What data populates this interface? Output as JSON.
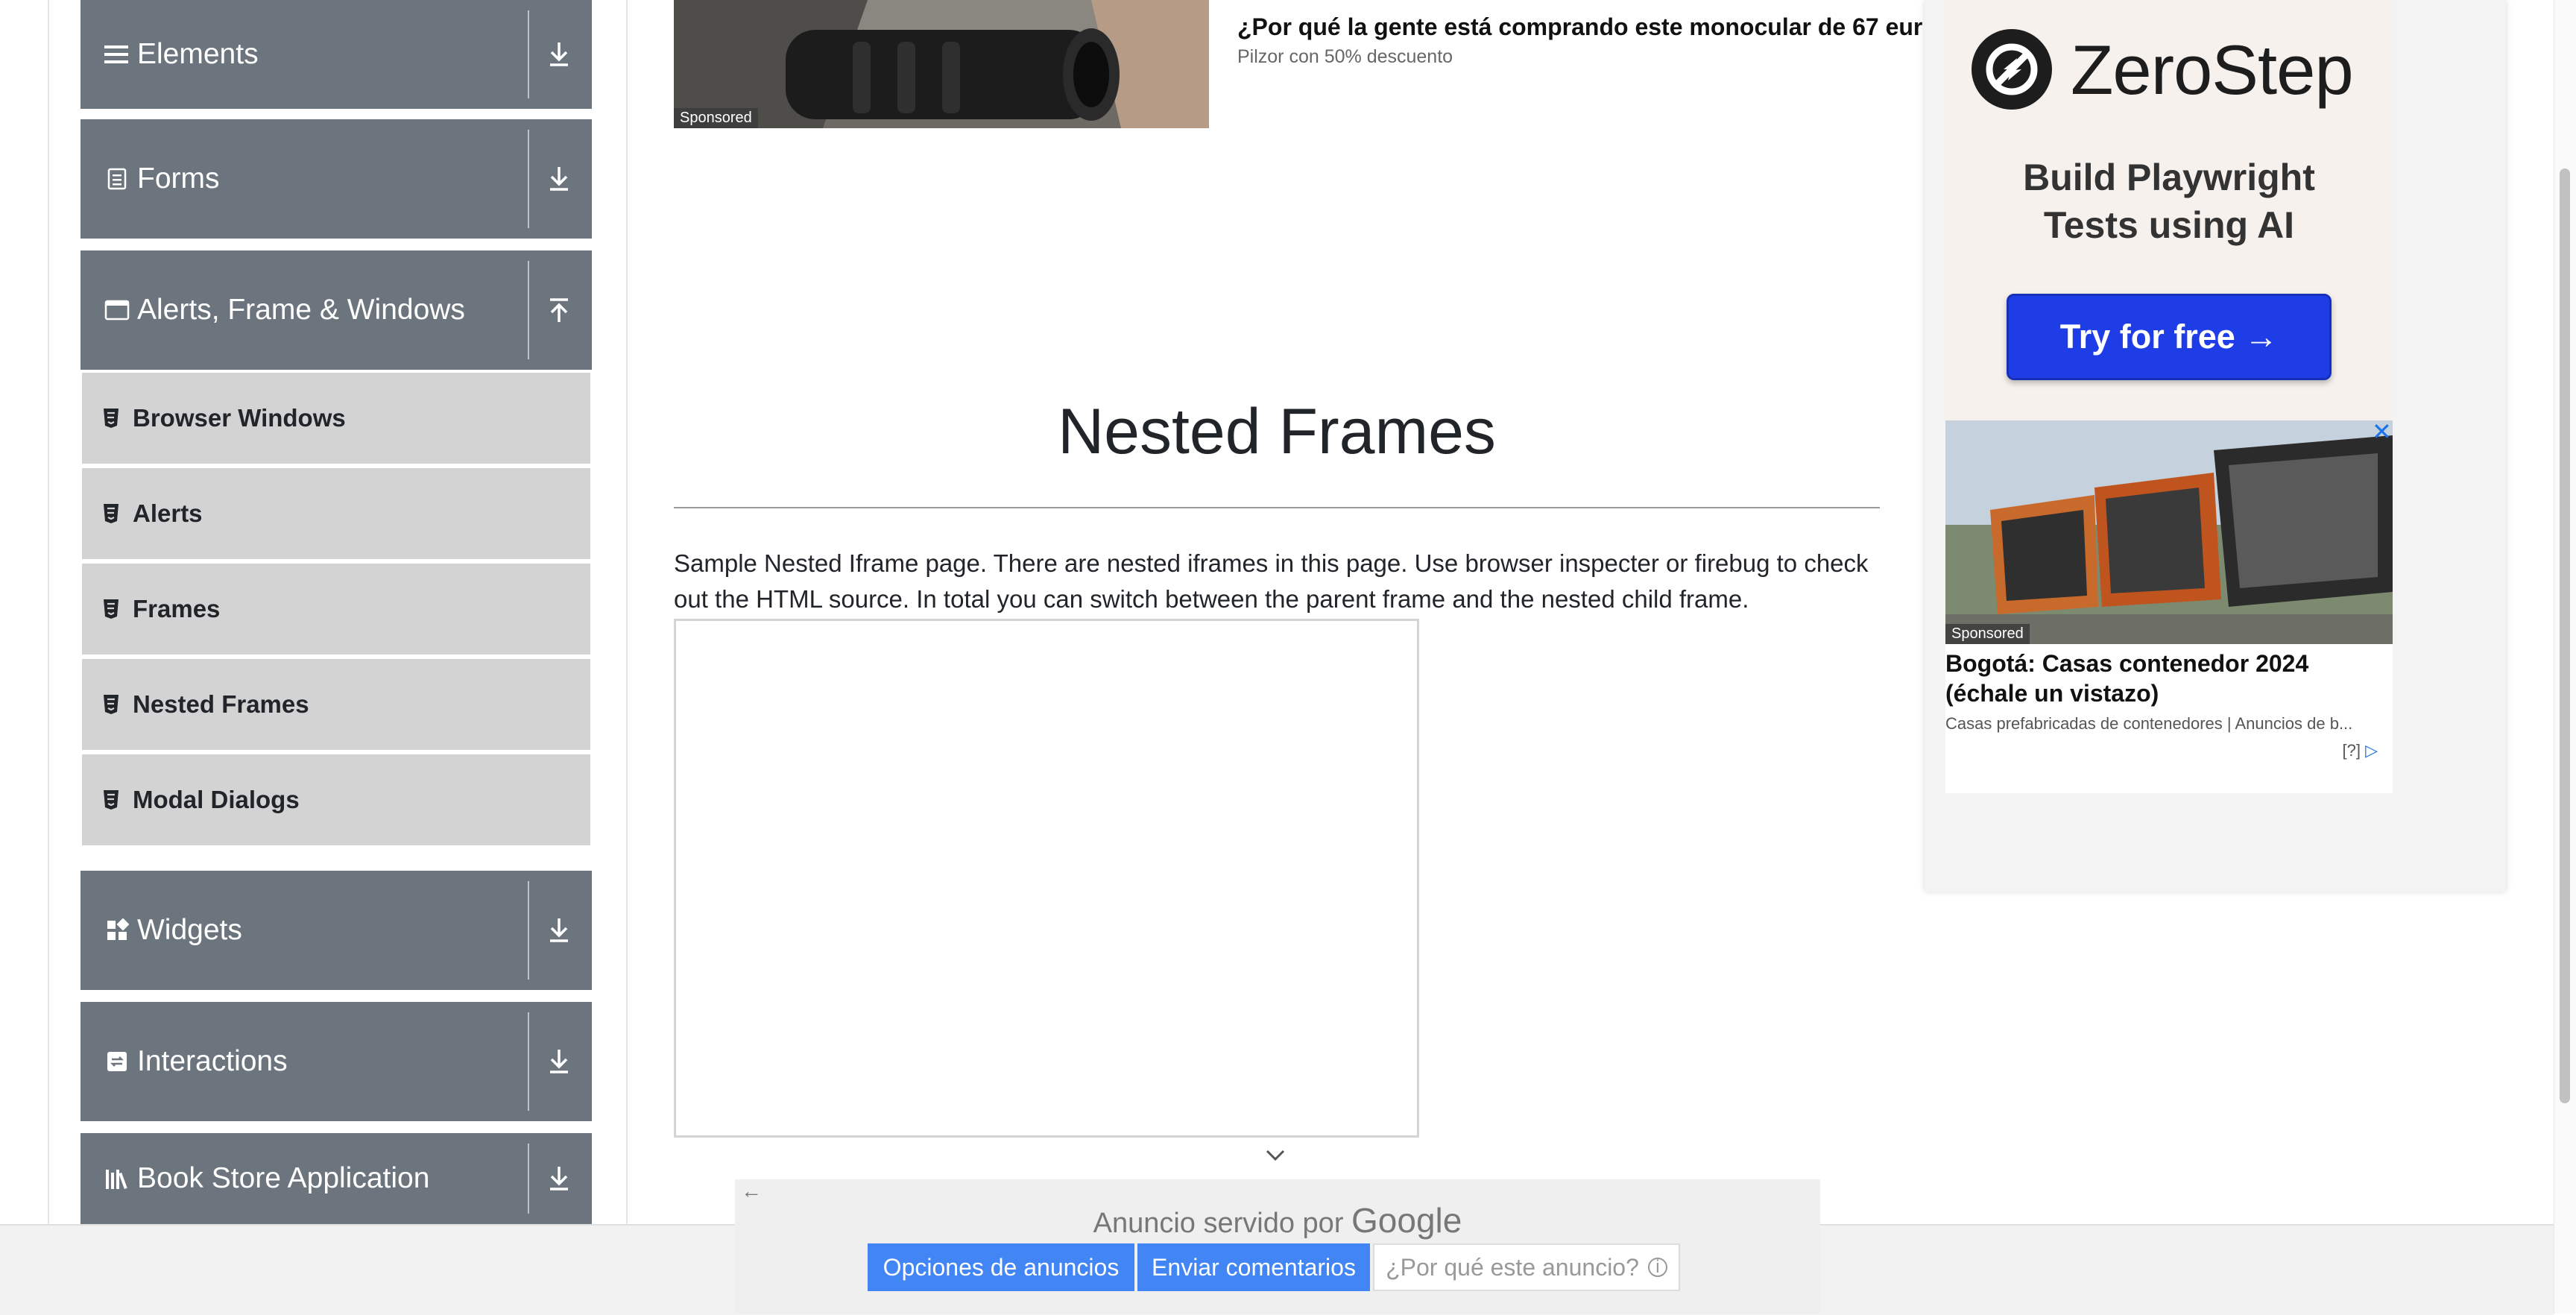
{
  "sidebar": {
    "groups": [
      {
        "label": "Elements",
        "icon": "hamburger-icon",
        "arrow": "download-arrow-icon"
      },
      {
        "label": "Forms",
        "icon": "document-icon",
        "arrow": "download-arrow-icon"
      },
      {
        "label": "Alerts, Frame & Windows",
        "icon": "window-icon",
        "arrow": "upload-arrow-icon"
      },
      {
        "label": "Widgets",
        "icon": "widgets-icon",
        "arrow": "download-arrow-icon"
      },
      {
        "label": "Interactions",
        "icon": "interactions-icon",
        "arrow": "download-arrow-icon"
      },
      {
        "label": "Book Store Application",
        "icon": "books-icon",
        "arrow": "download-arrow-icon"
      }
    ],
    "items": [
      {
        "label": "Browser Windows"
      },
      {
        "label": "Alerts"
      },
      {
        "label": "Frames"
      },
      {
        "label": "Nested Frames"
      },
      {
        "label": "Modal Dialogs"
      }
    ]
  },
  "top_ad": {
    "sponsored": "Sponsored",
    "title": "¿Por qué la gente está comprando este monocular de 67 eur",
    "subtitle": "Pilzor con 50% descuento"
  },
  "main": {
    "title": "Nested Frames",
    "description": "Sample Nested Iframe page. There are nested iframes in this page. Use browser inspecter or firebug to check out the HTML source. In total you can switch between the parent frame and the nested child frame."
  },
  "right_ad": {
    "brand": "ZeroStep",
    "headline_line1": "Build Playwright",
    "headline_line2": "Tests using AI",
    "cta": "Try for free →",
    "close": "✕",
    "native": {
      "sponsored": "Sponsored",
      "title": "Bogotá: Casas contenedor 2024 (échale un vistazo)",
      "subtitle": "Casas prefabricadas de contenedores | Anuncios de b...",
      "help": "[?]"
    }
  },
  "google_bar": {
    "served_by": "Anuncio servido por",
    "google": "Google",
    "buttons": {
      "options": "Opciones de anuncios",
      "feedback": "Enviar comentarios",
      "why": "¿Por qué este anuncio?"
    },
    "back": "←"
  },
  "colors": {
    "sidebar_group": "#6c757d",
    "sidebar_item": "#d3d3d3",
    "cta_blue": "#1f3de6",
    "google_blue": "#4285f4"
  }
}
